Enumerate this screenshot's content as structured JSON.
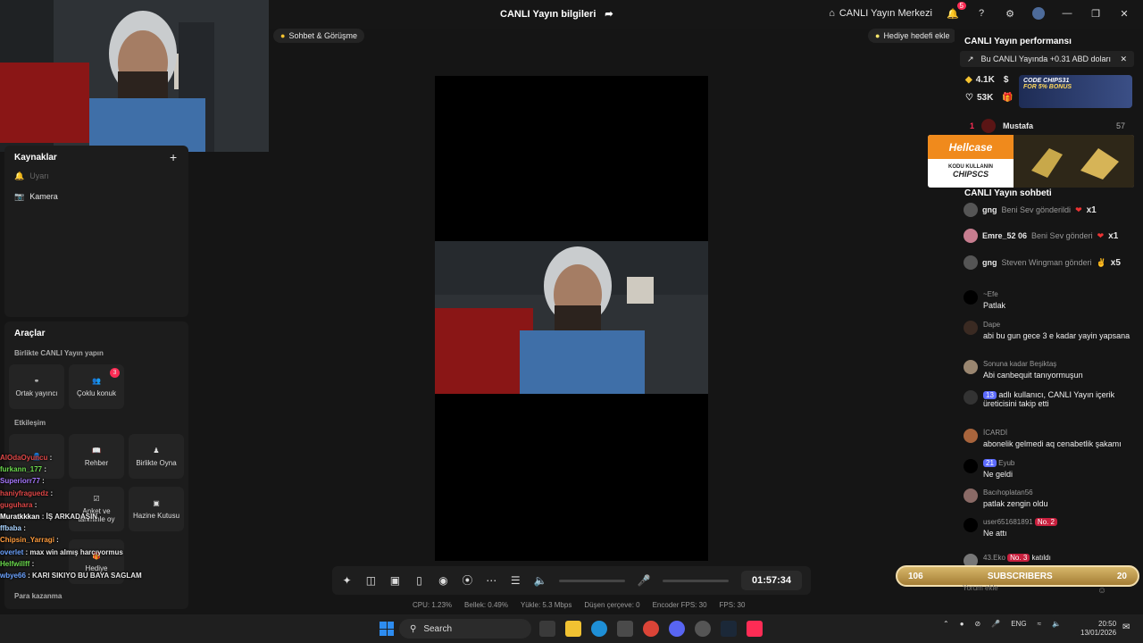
{
  "header": {
    "title": "CANLI Yayın bilgileri",
    "center_label": "CANLI Yayın Merkezi",
    "notif_count": "5"
  },
  "sidebar": {
    "sources_title": "Kaynaklar",
    "source_items": [
      "Uyarı",
      "Kamera"
    ],
    "tools_title": "Araçlar",
    "collab_subtitle": "Birlikte CANLI Yayın yapın",
    "collab_tiles": [
      {
        "label": "Ortak yayıncı"
      },
      {
        "label": "Çoklu konuk",
        "badge": "3"
      }
    ],
    "interaction_subtitle": "Etkileşim",
    "interaction_tiles": [
      {
        "label": "Rehber"
      },
      {
        "label": "Birlikte Oyna"
      },
      {
        "label": "Anket ve tahminle oy"
      },
      {
        "label": "Hazine Kutusu"
      },
      {
        "label": "Hediye"
      }
    ],
    "earn_subtitle": "Para kazanma"
  },
  "overlay_chat": [
    {
      "user": "AlOdaOyuncu",
      "text": ":"
    },
    {
      "user": "furkann_177",
      "text": ":"
    },
    {
      "user": "Superiorr77",
      "text": ":"
    },
    {
      "user": "haniyfraguedz",
      "text": ":"
    },
    {
      "user": "guguhara",
      "text": ":"
    },
    {
      "user": "Muratkkkan",
      "text": ": İŞ ARKADAŞIN"
    },
    {
      "user": "ffbaba",
      "text": ":"
    },
    {
      "user": "Chipsin_Yarragi",
      "text": ":"
    },
    {
      "user": "overlet",
      "text": ": max win almış harcıyormus"
    },
    {
      "user": "Helfwillff",
      "text": ":"
    },
    {
      "user": "wbye66",
      "text": ": KARI SIKIYO BU BAYA SAGLAM"
    }
  ],
  "stage": {
    "pill_left": "Sohbet & Görüşme",
    "pill_right": "Hediye hedefi ekle",
    "timer": "01:57:34",
    "stats": [
      "CPU: 1.23%",
      "Bellek: 0.49%",
      "Yükle: 5.3 Mbps",
      "Düşen çerçeve: 0",
      "Encoder FPS: 30",
      "FPS: 30"
    ]
  },
  "right": {
    "perf_title": "CANLI Yayın performansı",
    "earnings": "Bu CANLI Yayında +0.31 ABD doları",
    "diamonds": "4.1K",
    "likes": "53K",
    "ad_top_line1": "CODE CHIPS31",
    "ad_top_line2": "FOR 5% BONUS",
    "rank": {
      "pos": "1",
      "name": "Mustafa",
      "score": "57"
    },
    "hellcase": {
      "logo": "Hellcase",
      "code_label": "KODU KULLANIN",
      "code": "CHIPSCS"
    },
    "chat_title": "CANLI Yayın sohbeti",
    "gifts": [
      {
        "user": "gng",
        "action": "Beni Sev gönderildi",
        "count": "x1"
      },
      {
        "user": "Emre_52 06",
        "action": "Beni Sev gönderi",
        "count": "x1"
      },
      {
        "user": "gng",
        "action": "Steven Wingman gönderi",
        "count": "x5"
      }
    ],
    "messages": [
      {
        "name": "~Efe",
        "text": "Patlak"
      },
      {
        "name": "Dape",
        "text": "abi bu gun gece 3 e kadar yayin yapsana"
      },
      {
        "name": "Sonuna kadar Beşiktaş",
        "text": "Abi canbequit tanıyormuşun"
      },
      {
        "name": "",
        "text": "adlı kullanıcı, CANLI Yayın içerik üreticisini takip etti"
      },
      {
        "name": "İCARDİ",
        "text": "abonelik gelmedi aq cenabetlik şakamı"
      },
      {
        "name": "Eyub",
        "text": "Ne geldi"
      },
      {
        "name": "Bacıhoplatan56",
        "text": "patlak zengin oldu"
      },
      {
        "name": "user651681891",
        "text": "Ne attı"
      },
      {
        "name": "43.Eko",
        "text": "katıldı"
      }
    ],
    "follow_level": "13",
    "eyub_level": "21",
    "user_no": "No. 2",
    "eko_no": "No. 3",
    "subs": {
      "left": "106",
      "label": "SUBSCRIBERS",
      "right": "20"
    },
    "comment_placeholder": "Yorum ekle"
  },
  "taskbar": {
    "search": "Search",
    "lang": "ENG",
    "time": "20:50",
    "date": "13/01/2026"
  }
}
